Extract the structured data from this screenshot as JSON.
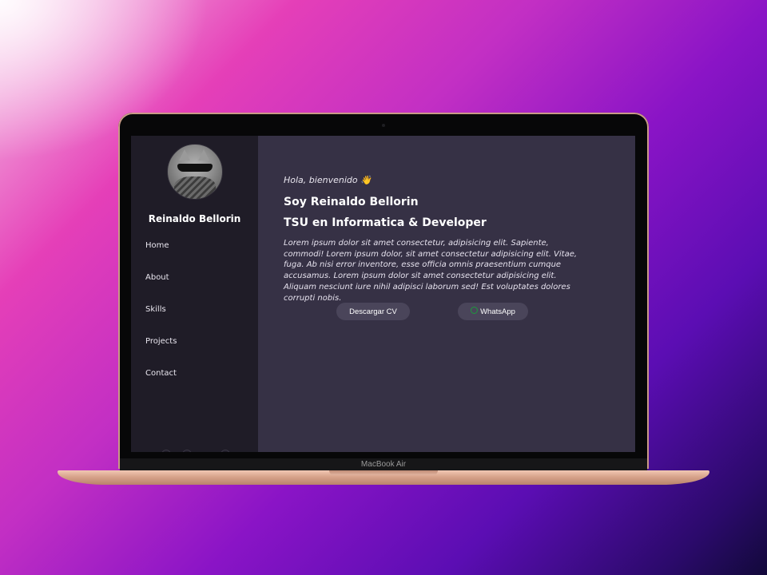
{
  "device": {
    "label": "MacBook Air"
  },
  "sidebar": {
    "profile_name": "Reinaldo Bellorin",
    "nav": [
      "Home",
      "About",
      "Skills",
      "Projects",
      "Contact"
    ]
  },
  "main": {
    "greeting": "Hola, bienvenido 👋",
    "name_line": "Soy Reinaldo Bellorin",
    "role_line": "TSU en Informatica & Developer",
    "intro": "Lorem ipsum dolor sit amet consectetur, adipisicing elit. Sapiente, commodi! Lorem ipsum dolor, sit amet consectetur adipisicing elit. Vitae, fuga. Ab nisi error inventore, esse officia omnis praesentium cumque accusamus. Lorem ipsum dolor sit amet consectetur adipisicing elit. Aliquam nesciunt iure nihil adipisci laborum sed! Est voluptates dolores corrupti nobis.",
    "buttons": {
      "cv": "Descargar CV",
      "whatsapp": "WhatsApp"
    }
  },
  "colors": {
    "sidebar_bg": "#1f1c27",
    "main_bg": "#363145",
    "button_bg": "#4a455a",
    "whatsapp_icon": "#1c9b3c"
  },
  "icons": [
    "avatar-photo",
    "whatsapp-icon",
    "wave-emoji"
  ]
}
